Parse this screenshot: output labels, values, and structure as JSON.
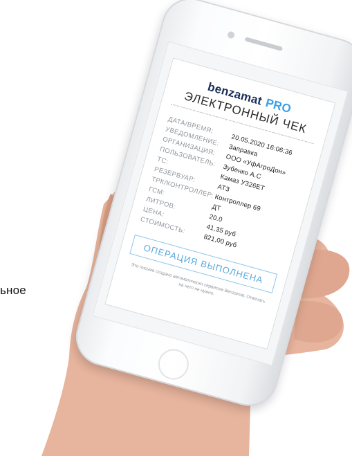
{
  "side_text": "ьное",
  "receipt": {
    "logo_brand": "benzamat",
    "logo_pro": "PRO",
    "title": "ЭЛЕКТРОННЫЙ ЧЕК",
    "fields": [
      {
        "label": "ДАТА/ВРЕМЯ:",
        "value": "20.05.2020 16:06:36"
      },
      {
        "label": "УВЕДОМЛЕНИЕ:",
        "value": "Заправка"
      },
      {
        "label": "ОРГАНИЗАЦИЯ:",
        "value": "ООО «УфАгроДон»"
      },
      {
        "label": "ПОЛЬЗОВАТЕЛЬ:",
        "value": "Зубенко А.С"
      },
      {
        "label": "ТС:",
        "value": "Камаз У326ЕТ"
      },
      {
        "label": "РЕЗЕРВУАР:",
        "value": "АТЗ"
      },
      {
        "label": "ТРК/КОНТРОЛЛЕР:",
        "value": "Контроллер 69"
      },
      {
        "label": "ГСМ:",
        "value": "ДТ"
      },
      {
        "label": "ЛИТРОВ:",
        "value": "20.0"
      },
      {
        "label": "ЦЕНА:",
        "value": "41,35 руб"
      },
      {
        "label": "СТОИМОСТЬ:",
        "value": "821,00 руб"
      }
    ],
    "status": "ОПЕРАЦИЯ ВЫПОЛНЕНА",
    "footer": "Это письмо создано автоматически сервисом Benzamat. Отвечать на него не нужно."
  }
}
